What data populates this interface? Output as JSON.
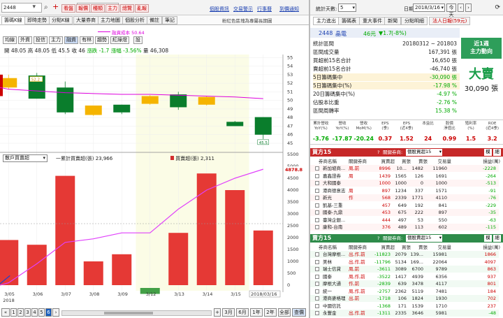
{
  "left_toolbar": {
    "stock_input": "2448",
    "stock_name": "晶電",
    "buttons": [
      "看盤",
      "報價",
      "種類",
      "主力",
      "總覽",
      "亂報"
    ],
    "links": [
      "個股資訊",
      "交易警示",
      "行事曆",
      "到價通知"
    ]
  },
  "tabs": [
    "籌碼K線",
    "即時走勢",
    "分點K線",
    "大量券商",
    "主力地圖",
    "個股分析",
    "備註",
    "筆記"
  ],
  "tabs_hint": "粉紅色區塊為專屬長期圖",
  "legend_top": "融資成本 50.64",
  "sub_tabs": [
    "均線",
    "外資",
    "投信",
    "主力",
    "融資",
    "有林",
    "趨勢",
    "紅綠燈",
    "設"
  ],
  "ohlc": {
    "open": "開 48.05",
    "high": "高 48.05",
    "low": "低 45.5",
    "close": "收 46",
    "chg": "漲跌 -1.7",
    "pct": "漲幅 -3.56%",
    "vol": "量 46,308"
  },
  "price_axis": [
    "56",
    "55",
    "54",
    "53",
    "52",
    "51",
    "50",
    "49",
    "48",
    "47",
    "46",
    "45"
  ],
  "price_labels": {
    "a": "52.2",
    "b": "45.5"
  },
  "vol_axis": [
    "5500",
    "5000",
    "4500",
    "4000",
    "3500",
    "3000",
    "2500",
    "2000",
    "1500",
    "1000",
    "500",
    "0"
  ],
  "vol_marker": "4878.8",
  "vol_select": "散戶買賣超",
  "vol_legend": {
    "l1": "一累計買賣超(張)",
    "v1": "23,966",
    "l2": "買賣超(張)",
    "v2": "2,311"
  },
  "dates": [
    "3/05",
    "3/06",
    "3/07",
    "3/08",
    "3/09",
    "3/12",
    "3/13",
    "3/14",
    "3/15",
    "3/16"
  ],
  "year": "2018",
  "date_tag": "2018/03/16",
  "pager": [
    "1",
    "2",
    "3",
    "4",
    "5",
    "6"
  ],
  "range_buttons": [
    "3月",
    "6月",
    "1年",
    "2年",
    "全部",
    "查價"
  ],
  "chart_data": [
    {
      "type": "bar",
      "title": "",
      "candles": [
        {
          "d": "3/05",
          "o": 51.5,
          "c": 52.6,
          "h": 53,
          "l": 51.3,
          "ext": true
        },
        {
          "d": "3/06",
          "o": 52.9,
          "c": 50.2,
          "h": 53.2,
          "l": 50.2
        },
        {
          "d": "3/07",
          "o": 51.5,
          "c": 48.6,
          "h": 52.2,
          "l": 48.4
        },
        {
          "d": "3/08",
          "o": 48.3,
          "c": 49.4,
          "h": 49.4,
          "l": 48.2
        },
        {
          "d": "3/09",
          "o": 49.5,
          "c": 48.6,
          "h": 49.5,
          "l": 48.4
        },
        {
          "d": "3/12",
          "o": 49.6,
          "c": 50.5,
          "h": 50.6,
          "l": 49.5
        },
        {
          "d": "3/13",
          "o": 50.7,
          "c": 49.2,
          "h": 51,
          "l": 48.9
        },
        {
          "d": "3/14",
          "o": 49.5,
          "c": 50.4,
          "h": 50.5,
          "l": 49.4
        },
        {
          "d": "3/15",
          "o": 47.5,
          "c": 47.0,
          "h": 47.6,
          "l": 47
        },
        {
          "d": "3/16",
          "o": 48.05,
          "c": 46,
          "h": 48.05,
          "l": 45.5
        }
      ],
      "ma": [
        51.3,
        51.1,
        50.9,
        50.8,
        50.7,
        50.7,
        50.6,
        50.5,
        50.4,
        50.2
      ],
      "ylim": [
        45,
        56
      ]
    },
    {
      "type": "bar",
      "title": "",
      "categories": [
        "3/05",
        "3/06",
        "3/07",
        "3/08",
        "3/09",
        "3/12",
        "3/13",
        "3/14",
        "3/15",
        "3/16"
      ],
      "values": [
        1900,
        1700,
        4600,
        1000,
        1300,
        -250,
        2200,
        4700,
        4000,
        2300
      ],
      "cumulative": [
        100,
        900,
        1800,
        1950,
        2200,
        2200,
        3200,
        4000,
        4500,
        4878.8
      ],
      "ylim": [
        0,
        5500
      ]
    }
  ],
  "right_top": {
    "period_label": "統計天數:",
    "period_value": "5",
    "date_label": "日期:",
    "date_value": "2018/3/16",
    "btn_today": "今天",
    "nav_prev": "‹",
    "nav_next": "›"
  },
  "right_tabs": [
    "主力進出",
    "籌碼表",
    "重大事件",
    "新聞",
    "分點明細",
    "法人日報(59元)"
  ],
  "stock_line": {
    "code": "2448",
    "name": "晶電",
    "price": "46元",
    "chg": "▼1.7",
    "pct": "(-8%)"
  },
  "stats": [
    {
      "k": "統計區間",
      "v": "20180312 ~ 201803"
    },
    {
      "k": "區間成交量",
      "v": "167,391 張"
    },
    {
      "k": "買超前15名合計",
      "v": "16,650 張"
    },
    {
      "k": "賣超前15名合計",
      "v": "-46,740 張"
    },
    {
      "k": "5日籌碼集中",
      "v": "-30,090 張"
    },
    {
      "k": "5日籌碼集中(%)",
      "v": "-17.98 %"
    },
    {
      "k": "20日籌碼集中(%)",
      "v": "-4.97 %"
    },
    {
      "k": "佔股本比重",
      "v": "-2.76 %"
    },
    {
      "k": "區間周轉率",
      "v": "15.38 %"
    }
  ],
  "side_panel": {
    "title1": "近1週",
    "title2": "主力動向",
    "big": "大賣",
    "amount": "30,090 張"
  },
  "metrics_headers": [
    "累計營收\nYoY(%)",
    "營收\nYoY(%)",
    "營收\nMoM(%)",
    "EPS\n(季)",
    "EPS\n(近4季)",
    "本益比",
    "股價\n淨值比",
    "殖利率\n(%)",
    "ROE\n(近4季)"
  ],
  "metrics_values": [
    "-3.76",
    "-17.87",
    "-20.24",
    "0.37",
    "1.52",
    "24",
    "0.99",
    "1.5",
    "3.2"
  ],
  "buy_section": {
    "title": "買方15",
    "check_label": "?",
    "sel_label": "關鍵券商:",
    "sel_value": "個股買超15",
    "btn1": "模",
    "btn2": "細"
  },
  "sell_section": {
    "title": "賣方15",
    "check_label": "?",
    "sel_label": "關鍵券商:",
    "sel_value": "個股賣超15",
    "btn1": "模",
    "btn2": "細"
  },
  "table_headers": [
    "券商名稱",
    "關鍵券商",
    "買賣超",
    "買張",
    "賣張",
    "交易量",
    "損益(萬)"
  ],
  "buy_rows": [
    [
      "新加坡商...",
      "周,前",
      "8996",
      "10...",
      "1482",
      "11960",
      "-2228"
    ],
    [
      "嘉鑫證券",
      "周",
      "1439",
      "1565",
      "126",
      "1691",
      "-264"
    ],
    [
      "大和國泰",
      "",
      "1000",
      "1000",
      "0",
      "1000",
      "-513"
    ],
    [
      "港商德意志",
      "周",
      "897",
      "1234",
      "337",
      "1571",
      "-91"
    ],
    [
      "新光",
      "作",
      "568",
      "2339",
      "1771",
      "4110",
      "-76"
    ],
    [
      "凱基-三重",
      "",
      "457",
      "649",
      "192",
      "841",
      "-229"
    ],
    [
      "國泰-九鼎",
      "",
      "453",
      "675",
      "222",
      "897",
      "-35"
    ],
    [
      "臺灣企銀...",
      "",
      "444",
      "497",
      "53",
      "550",
      "-63"
    ],
    [
      "康和-台南",
      "",
      "376",
      "489",
      "113",
      "602",
      "-115"
    ]
  ],
  "sell_rows": [
    [
      "台灣摩根...",
      "出,作,前",
      "-11823",
      "2079",
      "139...",
      "15981",
      "1866"
    ],
    [
      "美林",
      "出,作,前",
      "-11796",
      "5134",
      "169...",
      "22064",
      "4097"
    ],
    [
      "瑞士信貸",
      "周,前",
      "-3611",
      "3089",
      "6700",
      "9789",
      "863"
    ],
    [
      "國泰",
      "周,作,前",
      "-3522",
      "1417",
      "4939",
      "6356",
      "937"
    ],
    [
      "摩根大通",
      "作,前",
      "-2839",
      "639",
      "3478",
      "4117",
      "801"
    ],
    [
      "統一",
      "周,作,前",
      "-2757",
      "2362",
      "5119",
      "7481",
      "184"
    ],
    [
      "港商麥格理",
      "出,前",
      "-1718",
      "106",
      "1824",
      "1930",
      "702"
    ],
    [
      "中國信託",
      "",
      "-1368",
      "171",
      "1539",
      "1710",
      "237"
    ],
    [
      "永豐金",
      "出,作,前",
      "-1311",
      "2335",
      "3646",
      "5981",
      "-48"
    ]
  ]
}
